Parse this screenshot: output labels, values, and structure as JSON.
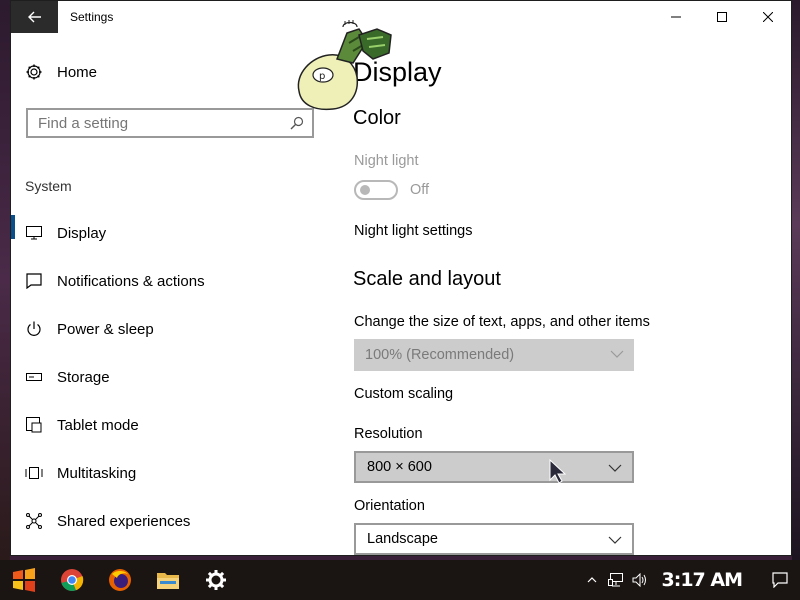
{
  "window": {
    "app_title": "Settings",
    "controls": {
      "minimize": "minimize-icon",
      "maximize": "maximize-icon",
      "close": "close-icon"
    }
  },
  "sidebar": {
    "home_label": "Home",
    "search": {
      "placeholder": "Find a setting",
      "value": ""
    },
    "section_label": "System",
    "items": [
      {
        "label": "Display",
        "icon": "monitor-icon",
        "active": true
      },
      {
        "label": "Notifications & actions",
        "icon": "notification-icon",
        "active": false
      },
      {
        "label": "Power & sleep",
        "icon": "power-icon",
        "active": false
      },
      {
        "label": "Storage",
        "icon": "storage-icon",
        "active": false
      },
      {
        "label": "Tablet mode",
        "icon": "tablet-icon",
        "active": false
      },
      {
        "label": "Multitasking",
        "icon": "multitasking-icon",
        "active": false
      },
      {
        "label": "Shared experiences",
        "icon": "shared-experiences-icon",
        "active": false
      }
    ]
  },
  "content": {
    "page_title": "Display",
    "color_heading": "Color",
    "night_light_label": "Night light",
    "night_light_state": "Off",
    "night_light_on": false,
    "night_light_settings_link": "Night light settings",
    "scale_heading": "Scale and layout",
    "scale_label": "Change the size of text, apps, and other items",
    "scale_value": "100% (Recommended)",
    "custom_scaling_link": "Custom scaling",
    "resolution_label": "Resolution",
    "resolution_value": "800 × 600",
    "orientation_label": "Orientation",
    "orientation_value": "Landscape"
  },
  "taskbar": {
    "pinned": [
      "start-icon",
      "chrome-icon",
      "firefox-icon",
      "file-explorer-icon",
      "settings-icon"
    ],
    "clock": "3:17 AM"
  },
  "colors": {
    "accent": "#0b4f8a",
    "taskbar_bg": "#1a1412",
    "titlebar_back_bg": "#2b2b2b"
  }
}
